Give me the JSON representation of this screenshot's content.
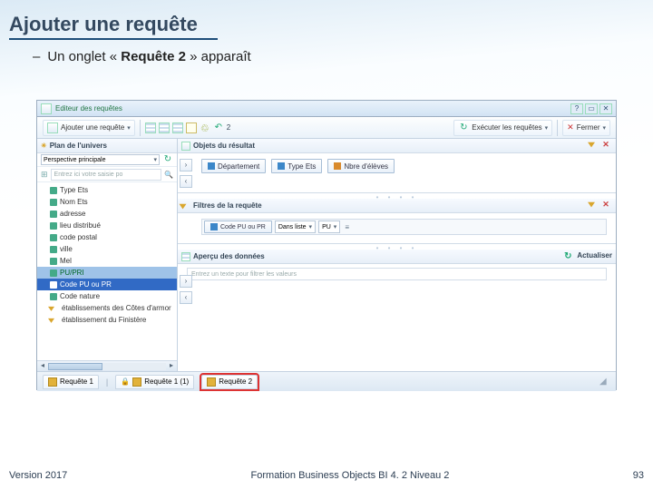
{
  "slide": {
    "title": "Ajouter une requête",
    "bullet_prefix": "Un onglet « ",
    "bullet_bold": "Requête 2",
    "bullet_suffix": " » apparaît"
  },
  "win": {
    "title": "Editeur des requêtes",
    "help_icon": "?",
    "max_icon": "▭",
    "close_icon": "✕"
  },
  "toolbar": {
    "add_query": "Ajouter une requête",
    "undo_count": "2",
    "run_queries": "Exécuter les requêtes",
    "close": "Fermer"
  },
  "left": {
    "plan": "Plan de l'univers",
    "perspective_label": "Perspective principale",
    "search_placeholder": "Entrez ici votre saisie po",
    "items": [
      "Type Ets",
      "Nom Ets",
      "adresse",
      "lieu distribué",
      "code postal",
      "ville",
      "Mel",
      "PU/PRI",
      "Code PU ou PR",
      "Code nature",
      "établissements des Côtes d'armor",
      "établissement du Finistère"
    ]
  },
  "right": {
    "obj_head": "Objets du résultat",
    "obj_items": [
      {
        "label": "Département",
        "type": "d"
      },
      {
        "label": "Type Ets",
        "type": "d"
      },
      {
        "label": "Nbre d'élèves",
        "type": "m"
      }
    ],
    "flt_head": "Filtres de la requête",
    "flt_chip": "Code PU ou PR",
    "flt_op": "Dans liste",
    "flt_val": "PU",
    "prev_head": "Aperçu des données",
    "prev_refresh": "Actualiser",
    "prev_placeholder": "Entrez un texte pour filtrer les valeurs"
  },
  "tabs": {
    "q1": "Requête 1",
    "q11": "Requête 1 (1)",
    "q2": "Requête 2"
  },
  "footer": {
    "version": "Version 2017",
    "center": "Formation Business Objects BI 4. 2 Niveau 2",
    "page": "93"
  }
}
